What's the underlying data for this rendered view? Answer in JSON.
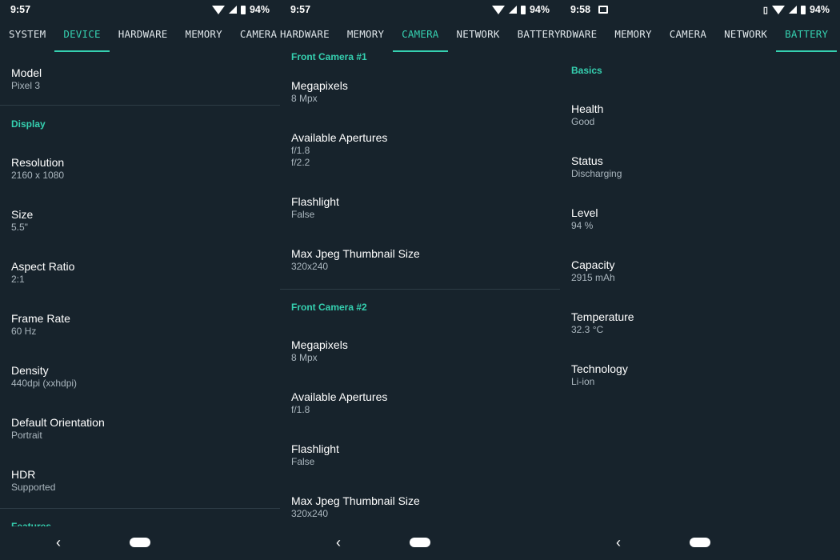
{
  "screens": [
    {
      "status": {
        "time": "9:57",
        "battery": "94%"
      },
      "tabs": [
        "SYSTEM",
        "DEVICE",
        "HARDWARE",
        "MEMORY",
        "CAMERA"
      ],
      "active_tab": "DEVICE",
      "model": {
        "title": "Model",
        "value": "Pixel 3"
      },
      "display_header": "Display",
      "items": [
        {
          "title": "Resolution",
          "value": "2160 x 1080"
        },
        {
          "title": "Size",
          "value": "5.5\""
        },
        {
          "title": "Aspect Ratio",
          "value": "2:1"
        },
        {
          "title": "Frame Rate",
          "value": "60 Hz"
        },
        {
          "title": "Density",
          "value": "440dpi (xxhdpi)"
        },
        {
          "title": "Default Orientation",
          "value": "Portrait"
        },
        {
          "title": "HDR",
          "value": "Supported"
        }
      ],
      "features_header": "Features"
    },
    {
      "status": {
        "time": "9:57",
        "battery": "94%"
      },
      "tabs": [
        "HARDWARE",
        "MEMORY",
        "CAMERA",
        "NETWORK",
        "BATTERY"
      ],
      "active_tab": "CAMERA",
      "camera1_header": "Front Camera #1",
      "camera1": [
        {
          "title": "Megapixels",
          "value": "8 Mpx"
        },
        {
          "title": "Available Apertures",
          "value": "f/1.8",
          "value2": "f/2.2"
        },
        {
          "title": "Flashlight",
          "value": "False"
        },
        {
          "title": "Max Jpeg Thumbnail Size",
          "value": "320x240"
        }
      ],
      "camera2_header": "Front Camera #2",
      "camera2": [
        {
          "title": "Megapixels",
          "value": "8 Mpx"
        },
        {
          "title": "Available Apertures",
          "value": "f/1.8"
        },
        {
          "title": "Flashlight",
          "value": "False"
        },
        {
          "title": "Max Jpeg Thumbnail Size",
          "value": "320x240"
        }
      ]
    },
    {
      "status": {
        "time": "9:58",
        "battery": "94%"
      },
      "tabs": [
        "RDWARE",
        "MEMORY",
        "CAMERA",
        "NETWORK",
        "BATTERY"
      ],
      "active_tab": "BATTERY",
      "basics_header": "Basics",
      "items": [
        {
          "title": "Health",
          "value": "Good"
        },
        {
          "title": "Status",
          "value": "Discharging"
        },
        {
          "title": "Level",
          "value": "94 %"
        },
        {
          "title": "Capacity",
          "value": "2915 mAh"
        },
        {
          "title": "Temperature",
          "value": "32.3 °C"
        },
        {
          "title": "Technology",
          "value": "Li-ion"
        }
      ]
    }
  ],
  "nav": {
    "back_glyph": "‹"
  },
  "colors": {
    "background": "#17232c",
    "accent": "#35d0b0",
    "divider": "#2e3c46",
    "secondary_text": "#aab6be"
  }
}
